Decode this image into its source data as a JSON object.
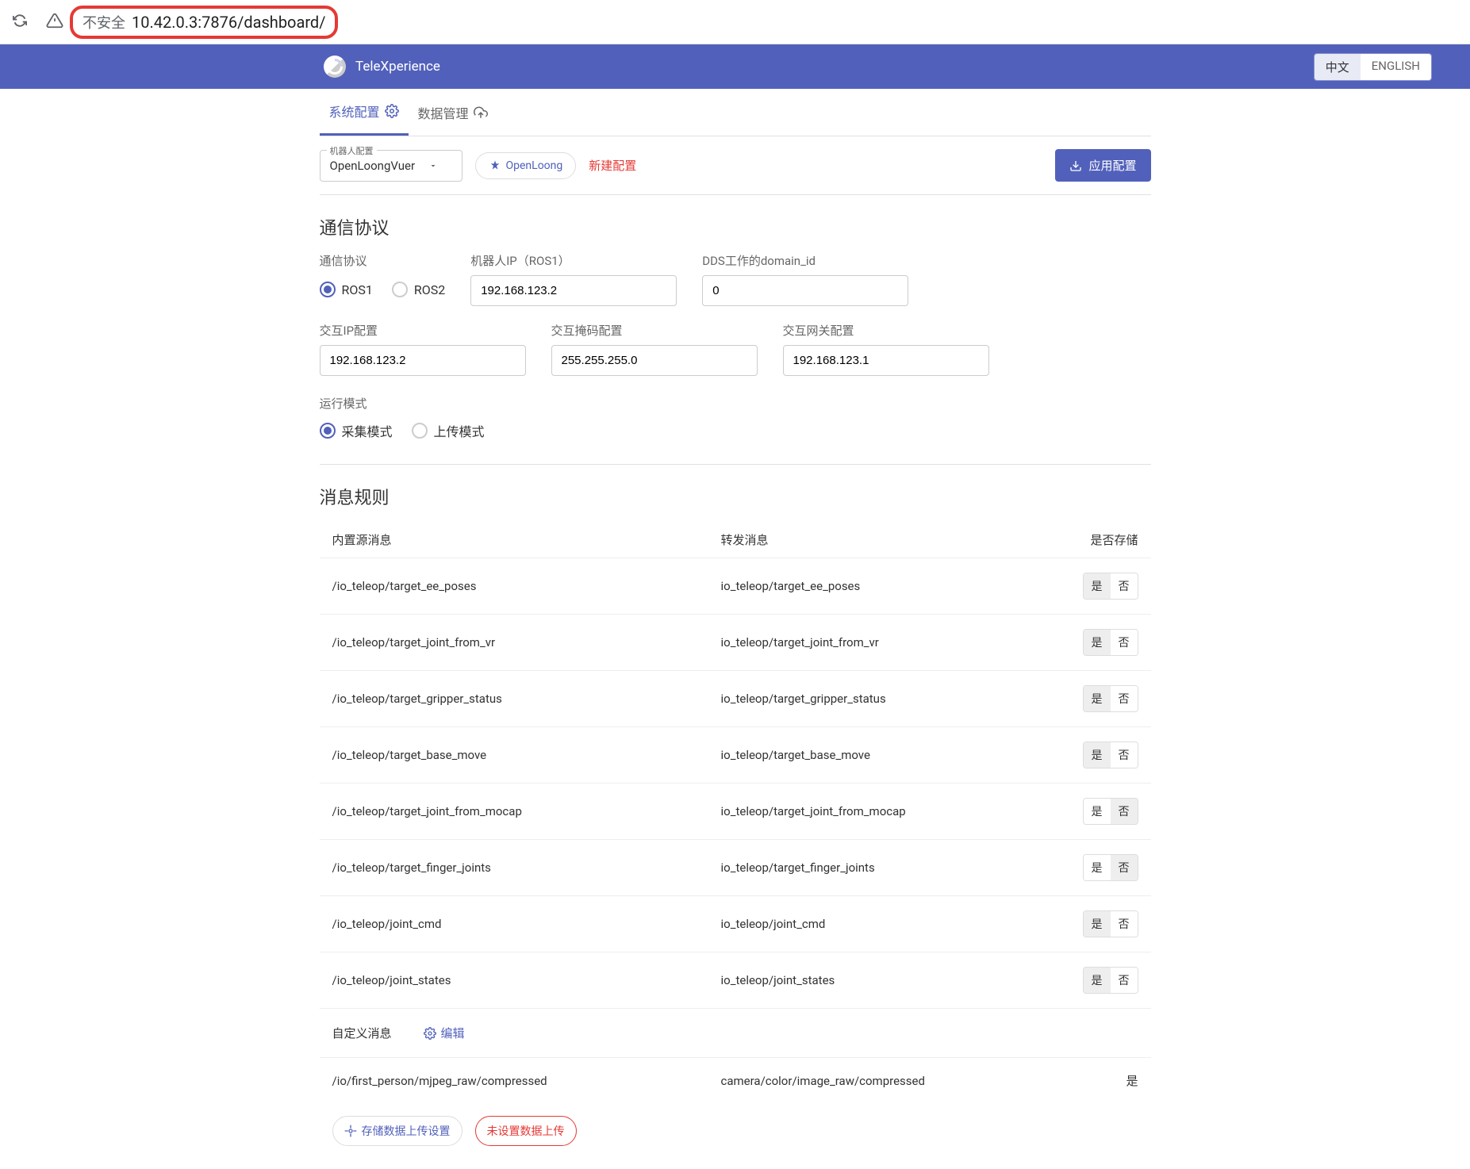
{
  "browser": {
    "security_text": "不安全",
    "url": "10.42.0.3:7876/dashboard/"
  },
  "header": {
    "brand": "TeleXperience",
    "lang_cn": "中文",
    "lang_en": "ENGLISH"
  },
  "tabs": {
    "system_config": "系统配置",
    "data_mgmt": "数据管理"
  },
  "config_bar": {
    "robot_config_label": "机器人配置",
    "robot_config_value": "OpenLoongVuer",
    "openloong_btn": "OpenLoong",
    "new_config": "新建配置",
    "apply_btn": "应用配置"
  },
  "comm": {
    "section_title": "通信协议",
    "protocol_label": "通信协议",
    "ros1": "ROS1",
    "ros2": "ROS2",
    "robot_ip_label": "机器人IP（ROS1）",
    "robot_ip_value": "192.168.123.2",
    "domain_id_label": "DDS工作的domain_id",
    "domain_id_value": "0",
    "inter_ip_label": "交互IP配置",
    "inter_ip_value": "192.168.123.2",
    "mask_label": "交互掩码配置",
    "mask_value": "255.255.255.0",
    "gateway_label": "交互网关配置",
    "gateway_value": "192.168.123.1",
    "run_mode_label": "运行模式",
    "collect_mode": "采集模式",
    "upload_mode": "上传模式"
  },
  "rules": {
    "section_title": "消息规则",
    "col_source": "内置源消息",
    "col_forward": "转发消息",
    "col_store": "是否存储",
    "yes": "是",
    "no": "否",
    "rows": [
      {
        "source": "/io_teleop/target_ee_poses",
        "forward": "io_teleop/target_ee_poses",
        "store": true
      },
      {
        "source": "/io_teleop/target_joint_from_vr",
        "forward": "io_teleop/target_joint_from_vr",
        "store": true
      },
      {
        "source": "/io_teleop/target_gripper_status",
        "forward": "io_teleop/target_gripper_status",
        "store": true
      },
      {
        "source": "/io_teleop/target_base_move",
        "forward": "io_teleop/target_base_move",
        "store": true
      },
      {
        "source": "/io_teleop/target_joint_from_mocap",
        "forward": "io_teleop/target_joint_from_mocap",
        "store": false
      },
      {
        "source": "/io_teleop/target_finger_joints",
        "forward": "io_teleop/target_finger_joints",
        "store": false
      },
      {
        "source": "/io_teleop/joint_cmd",
        "forward": "io_teleop/joint_cmd",
        "store": true
      },
      {
        "source": "/io_teleop/joint_states",
        "forward": "io_teleop/joint_states",
        "store": true
      }
    ],
    "custom_msg_label": "自定义消息",
    "edit_label": "编辑",
    "custom_row": {
      "source": "/io/first_person/mjpeg_raw/compressed",
      "forward": "camera/color/image_raw/compressed",
      "store_text": "是"
    }
  },
  "bottom": {
    "upload_settings": "存储数据上传设置",
    "upload_not_set": "未设置数据上传"
  }
}
